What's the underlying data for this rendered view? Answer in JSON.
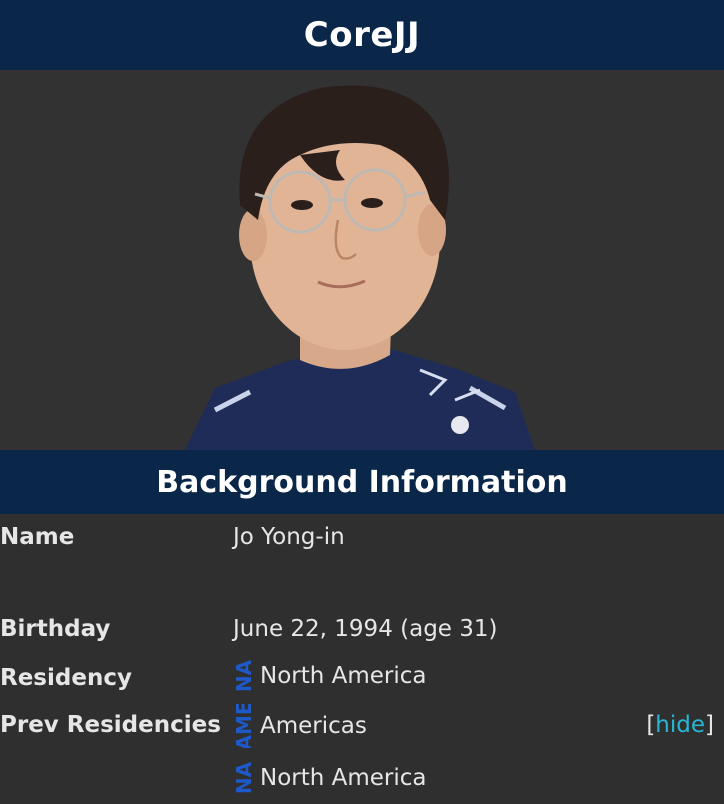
{
  "infobox": {
    "title": "CoreJJ",
    "photo_alt": "player-portrait",
    "section_title": "Background Information",
    "rows": {
      "name": {
        "label": "Name",
        "value": "Jo Yong-in"
      },
      "birthday": {
        "label": "Birthday",
        "value": "June 22, 1994 (age 31)"
      },
      "residency": {
        "label": "Residency",
        "code": "NA",
        "value": "North America"
      },
      "prev_residencies": {
        "label": "Prev Residencies",
        "items": [
          {
            "code": "AME",
            "value": "Americas"
          },
          {
            "code": "NA",
            "value": "North America"
          }
        ],
        "toggle_open": "[",
        "toggle_label": "hide",
        "toggle_close": "]"
      }
    }
  },
  "colors": {
    "header_bg": "#0a2749",
    "body_bg": "#2f2f2f",
    "link": "#27b7d4",
    "flag_code": "#1e58c9"
  }
}
